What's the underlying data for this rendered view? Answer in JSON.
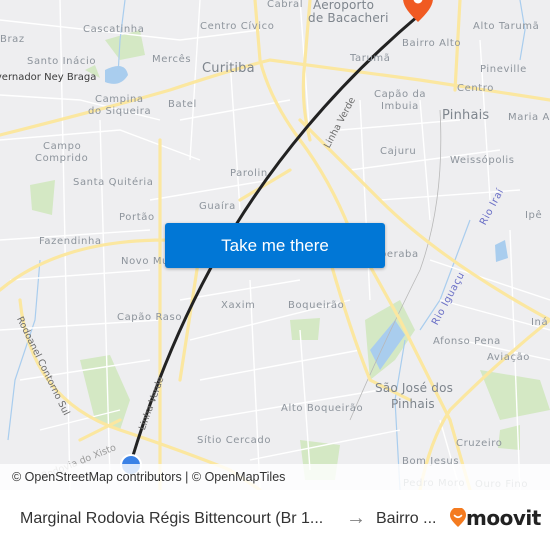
{
  "map": {
    "labels": {
      "cabral": "Cabral",
      "aeroporto": "Aeroporto",
      "de_bacacheri": "de Bacacheri",
      "bairro_top": "Bairro",
      "braz": "Braz",
      "cascatinha": "Cascatinha",
      "centro_civico": "Centro Cívico",
      "alto_taruma": "Alto Tarumã",
      "santo_inacio": "Santo Inácio",
      "merces": "Mercês",
      "curitiba": "Curitiba",
      "taruma": "Tarumã",
      "bairro_alto": "Bairro Alto",
      "pineville": "Pineville",
      "governador": "Governador Ney Braga",
      "campina": "Campina",
      "do_siqueira": "do Siqueira",
      "batel": "Batel",
      "capao_da": "Capão da",
      "imbuia": "Imbuia",
      "centro": "Centro",
      "pinhais": "Pinhais",
      "maria_an": "Maria An",
      "campo": "Campo",
      "comprido": "Comprido",
      "cajuru": "Cajuru",
      "weissopolis": "Weissópolis",
      "santa_quiteria": "Santa Quitéria",
      "parolin": "Parolin",
      "guaira": "Guaíra",
      "portao": "Portão",
      "ipe": "Ipê",
      "fazendinha": "Fazendinha",
      "novo_mundo": "Novo Mundo",
      "uberaba": "Uberaba",
      "xaxim": "Xaxim",
      "boqueirao": "Boqueirão",
      "capao_raso": "Capão Raso",
      "ina": "Iná",
      "afonso_pena": "Afonso Pena",
      "aviacao": "Aviação",
      "sao_jose": "São José dos",
      "sao_jose_2": "Pinhais",
      "alto_boqueirao": "Alto Boqueirão",
      "sitio_cercado": "Sítio Cercado",
      "cruzeiro": "Cruzeiro",
      "bom_jesus": "Bom Jesus",
      "pedro_moro": "Pedro Moro",
      "ouro_fino": "Ouro Fino",
      "rodoanel": "Rodoanel Contorno Sul",
      "linha_verde_top": "Linha Verde",
      "linha_verde_bottom": "Linha Verde",
      "yisto": "Rodovia do Xisto",
      "rio_irai": "Rio Iraí",
      "rio_iguacu": "Rio Iguaçu"
    },
    "attribution": "© OpenStreetMap contributors | © OpenMapTiles",
    "colors": {
      "route": "#222222",
      "origin_marker": "#3b82e6",
      "destination_marker": "#f05a22",
      "button": "#0177d6"
    }
  },
  "cta": {
    "label": "Take me there"
  },
  "footer": {
    "origin": "Marginal Rodovia Régis Bittencourt (Br 1...",
    "arrow": "→",
    "destination": "Bairro ...",
    "brand": "moovit"
  }
}
